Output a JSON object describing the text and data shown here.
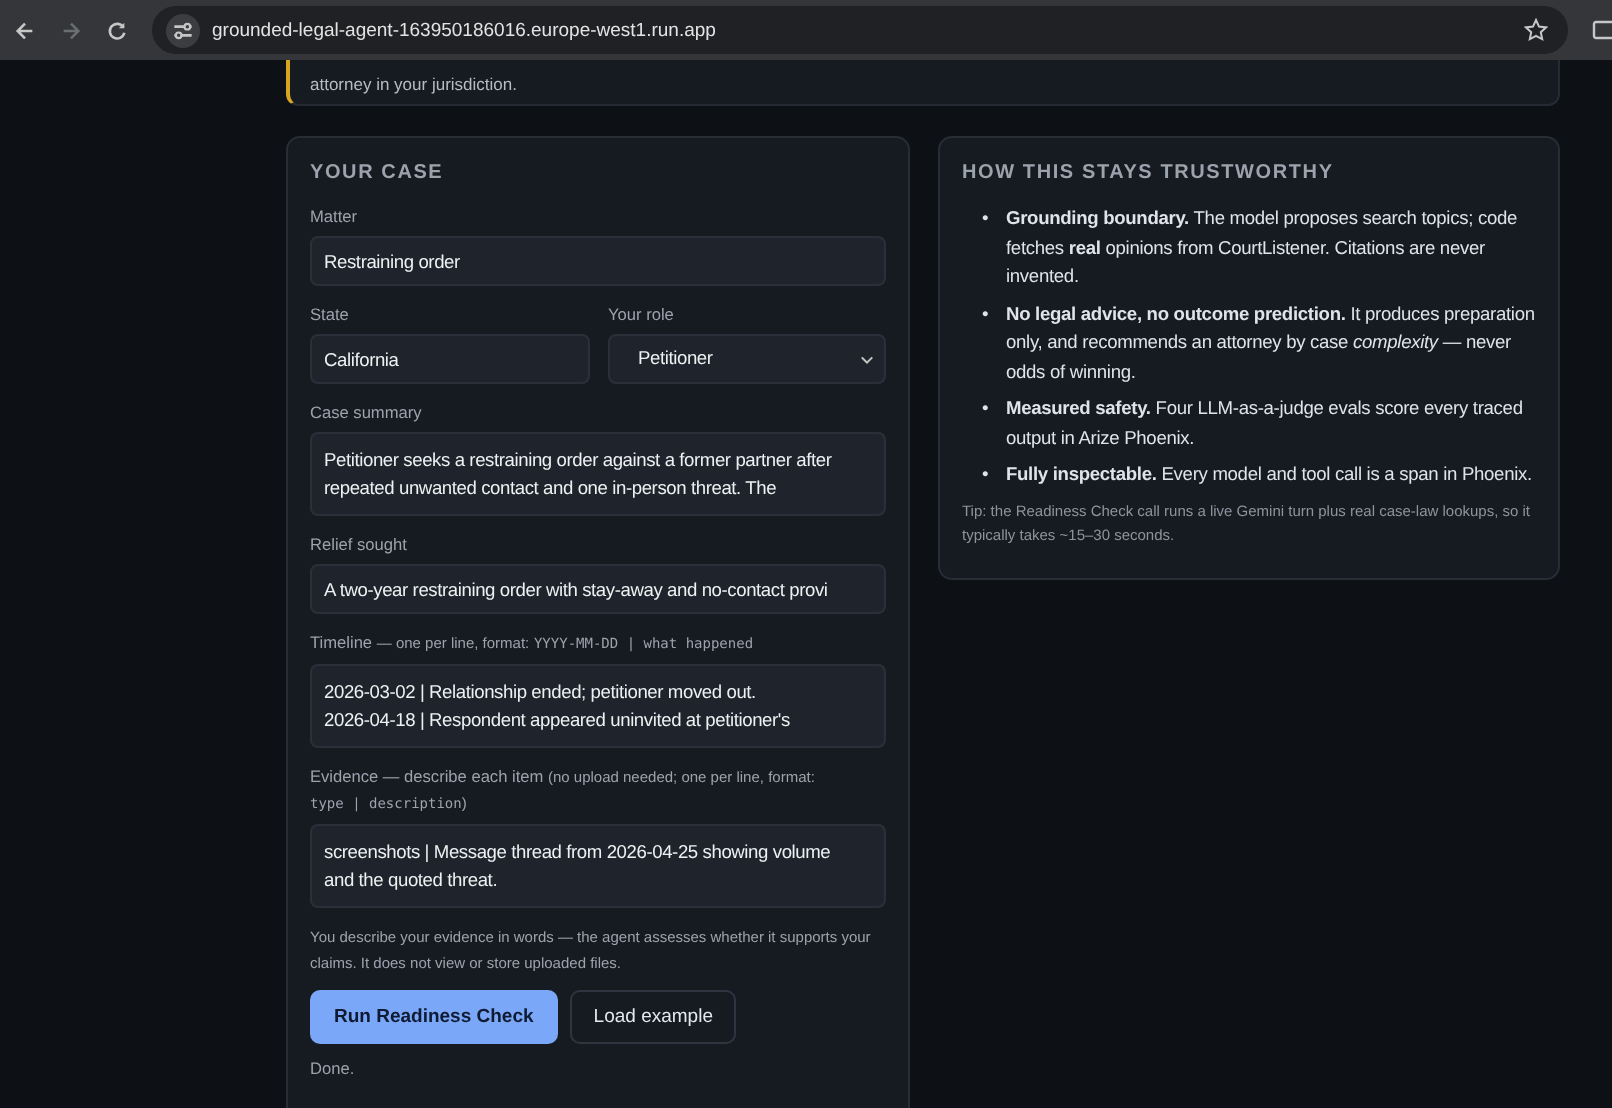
{
  "browser": {
    "url": "grounded-legal-agent-163950186016.europe-west1.run.app",
    "forward_disabled": true
  },
  "notice": {
    "text": "attorney in your jurisdiction."
  },
  "case_form": {
    "title": "YOUR CASE",
    "matter": {
      "label": "Matter",
      "value": "Restraining order"
    },
    "state": {
      "label": "State",
      "value": "California"
    },
    "role": {
      "label": "Your role",
      "value": "Petitioner"
    },
    "summary": {
      "label": "Case summary",
      "lines": [
        "Petitioner seeks a restraining order against a former partner after",
        "repeated unwanted contact and one in-person threat. The"
      ]
    },
    "relief": {
      "label": "Relief sought",
      "value": "A two-year restraining order with stay-away and no-contact provi"
    },
    "timeline": {
      "label": "Timeline",
      "hint": [
        {
          "kind": "text",
          "text": "— one per line, format:"
        },
        {
          "kind": "code",
          "text": "YYYY-MM-DD | what happened"
        }
      ],
      "lines": [
        "2026-03-02 | Relationship ended; petitioner moved out.",
        "2026-04-18 | Respondent appeared uninvited at petitioner's"
      ]
    },
    "evidence": {
      "label": "Evidence — describe each item",
      "hint": [
        {
          "kind": "text",
          "text": "(no upload needed; one per line, format:"
        },
        {
          "kind": "code",
          "text": "type | description"
        },
        {
          "kind": "text",
          "text": ")"
        }
      ],
      "lines": [
        "screenshots | Message thread from 2026-04-25 showing volume",
        "and the quoted threat."
      ]
    },
    "note": "You describe your evidence in words — the agent assesses whether it supports your claims. It does not view or store uploaded files.",
    "buttons": [
      {
        "label": "Run Readiness Check",
        "kind": "primary"
      },
      {
        "label": "Load example",
        "kind": "secondary"
      }
    ],
    "status": "Done."
  },
  "trust": {
    "title": "HOW THIS STAYS TRUSTWORTHY",
    "items": [
      {
        "marker": "•",
        "text": "**Grounding boundary.** The model proposes search topics; code fetches **real** opinions from CourtListener. Citations are never invented."
      },
      {
        "marker": "•",
        "text": "**No legal advice, no outcome prediction.** It produces preparation only, and recommends an attorney by case *complexity* — never odds of winning."
      },
      {
        "marker": "•",
        "text": "**Measured safety.** Four LLM-as-a-judge evals score every traced output in Arize Phoenix."
      },
      {
        "marker": "•",
        "text": "**Fully inspectable.** Every model and tool call is a span in Phoenix."
      }
    ],
    "tip": "Tip: the Readiness Check call runs a live Gemini turn plus real case-law lookups, so it typically takes ~15–30 seconds."
  }
}
